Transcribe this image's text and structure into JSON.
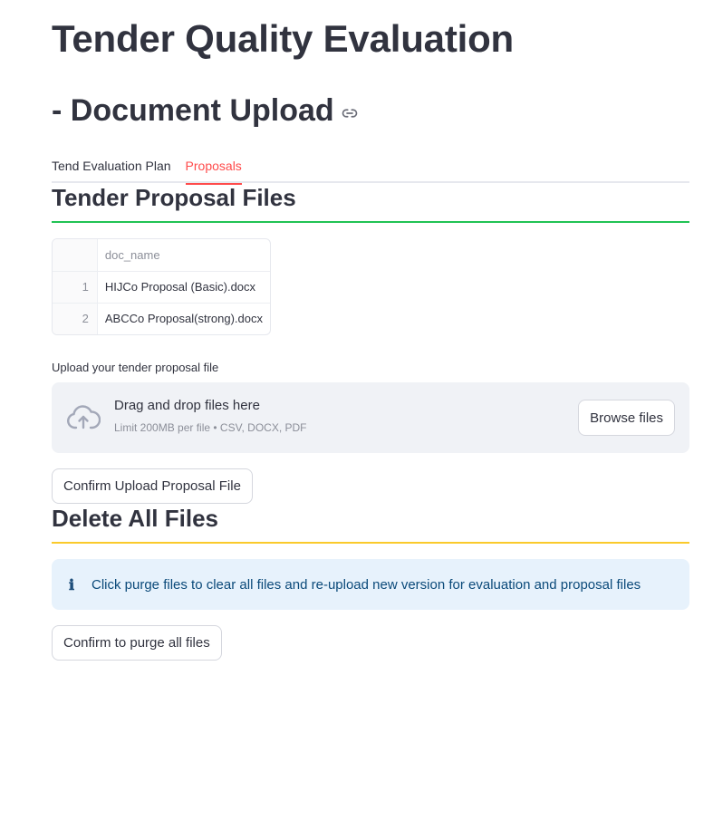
{
  "header": {
    "title": "Tender Quality Evaluation",
    "subtitle": "- Document Upload"
  },
  "tabs": [
    {
      "label": "Tend Evaluation Plan",
      "active": false
    },
    {
      "label": "Proposals",
      "active": true
    }
  ],
  "proposal_section": {
    "heading": "Tender Proposal Files",
    "table": {
      "columns": [
        "",
        "doc_name"
      ],
      "rows": [
        {
          "index": "1",
          "doc_name": "HIJCo Proposal (Basic).docx"
        },
        {
          "index": "2",
          "doc_name": "ABCCo Proposal(strong).docx"
        }
      ]
    },
    "upload": {
      "label": "Upload your tender proposal file",
      "drop_text": "Drag and drop files here",
      "limit_text": "Limit 200MB per file • CSV, DOCX, PDF",
      "browse_label": "Browse files"
    },
    "confirm_label": "Confirm Upload Proposal File"
  },
  "delete_section": {
    "heading": "Delete All Files",
    "info_text": "Click purge files to clear all files and re-upload new version for evaluation and proposal files",
    "purge_label": "Confirm to purge all files"
  },
  "colors": {
    "accent": "#ff4b4b",
    "green_divider": "#21c354",
    "orange_divider": "#faca2b",
    "info_bg": "#e7f2fc"
  },
  "icons": {
    "anchor": "link-icon",
    "upload": "cloud-upload-icon",
    "info": "info-icon"
  }
}
